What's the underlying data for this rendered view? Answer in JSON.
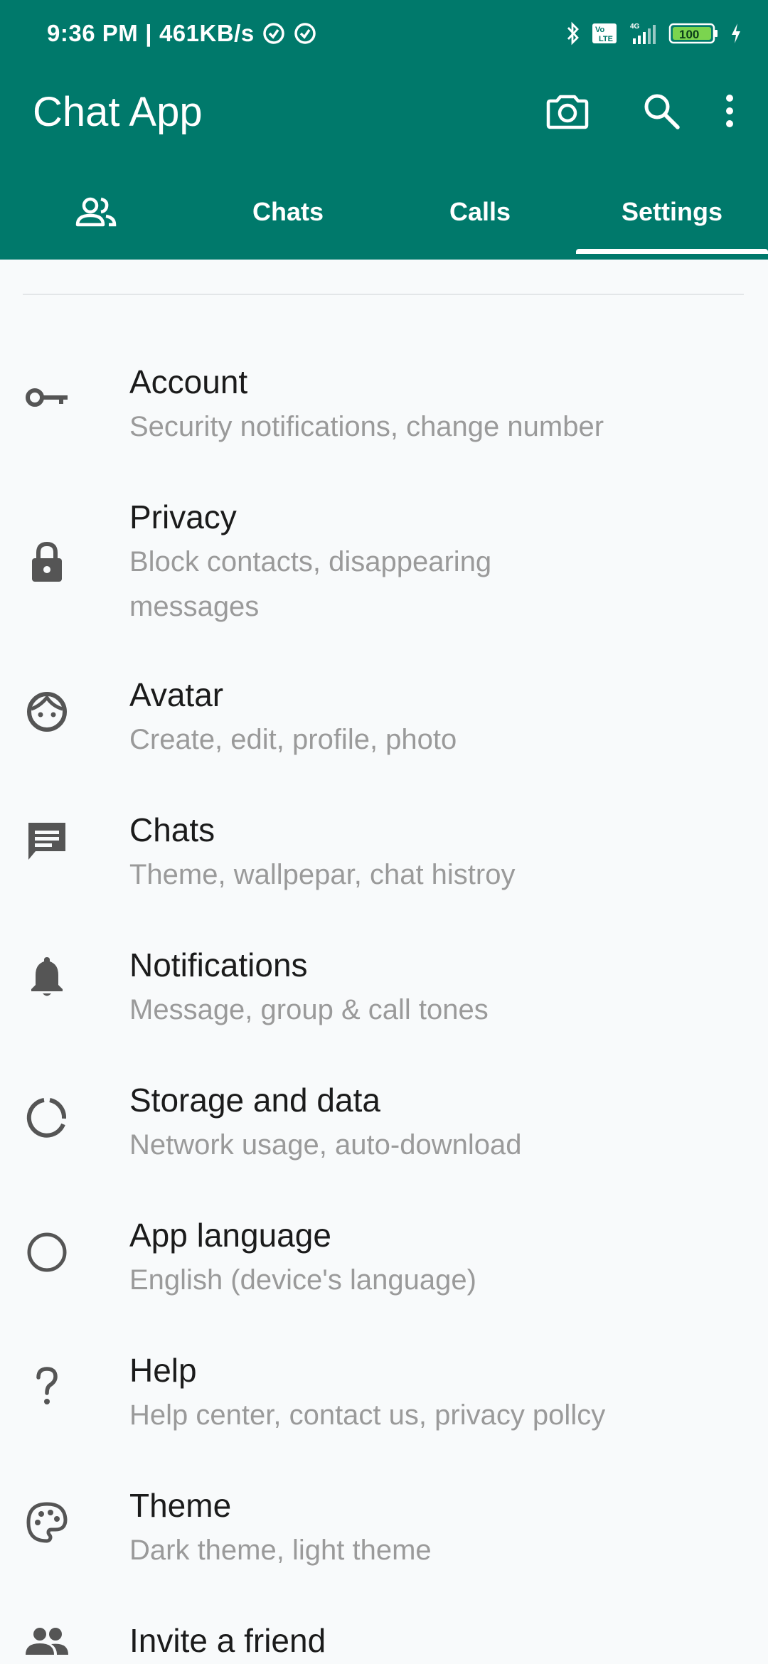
{
  "status_bar": {
    "time": "9:36 PM",
    "separator": "|",
    "speed": "461KB/s",
    "battery": "100",
    "network": "4G",
    "volte": "Vo LTE"
  },
  "app_bar": {
    "title": "Chat App",
    "actions": [
      "camera-icon",
      "search-icon",
      "more-vert-icon"
    ]
  },
  "tabs": [
    {
      "label": "",
      "icon": "community-icon",
      "active": false
    },
    {
      "label": "Chats",
      "active": false
    },
    {
      "label": "Calls",
      "active": false
    },
    {
      "label": "Settings",
      "active": true
    }
  ],
  "settings": [
    {
      "title": "Account",
      "subtitle": "Security notifications, change number",
      "icon": "key-icon"
    },
    {
      "title": "Privacy",
      "subtitle": "Block contacts, disappearing messages",
      "icon": "lock-icon"
    },
    {
      "title": "Avatar",
      "subtitle": "Create, edit, profile, photo",
      "icon": "face-icon"
    },
    {
      "title": "Chats",
      "subtitle": "Theme, wallpepar, chat histroy",
      "icon": "chat-icon"
    },
    {
      "title": "Notifications",
      "subtitle": "Message, group & call tones",
      "icon": "bell-icon"
    },
    {
      "title": "Storage and data",
      "subtitle": "Network usage, auto-download",
      "icon": "data-usage-icon"
    },
    {
      "title": "App language",
      "subtitle": "English (device's language)",
      "icon": "circle-icon"
    },
    {
      "title": "Help",
      "subtitle": "Help center, contact us, privacy pollcy",
      "icon": "question-icon"
    },
    {
      "title": "Theme",
      "subtitle": "Dark theme, light theme",
      "icon": "palette-icon"
    },
    {
      "title": "Invite a friend",
      "subtitle": "",
      "icon": "people-icon"
    }
  ],
  "colors": {
    "header": "#00796b",
    "icon": "#555555",
    "title_text": "#1b1b1b",
    "subtitle_text": "#9a9a9a",
    "background": "#f8fafb"
  }
}
